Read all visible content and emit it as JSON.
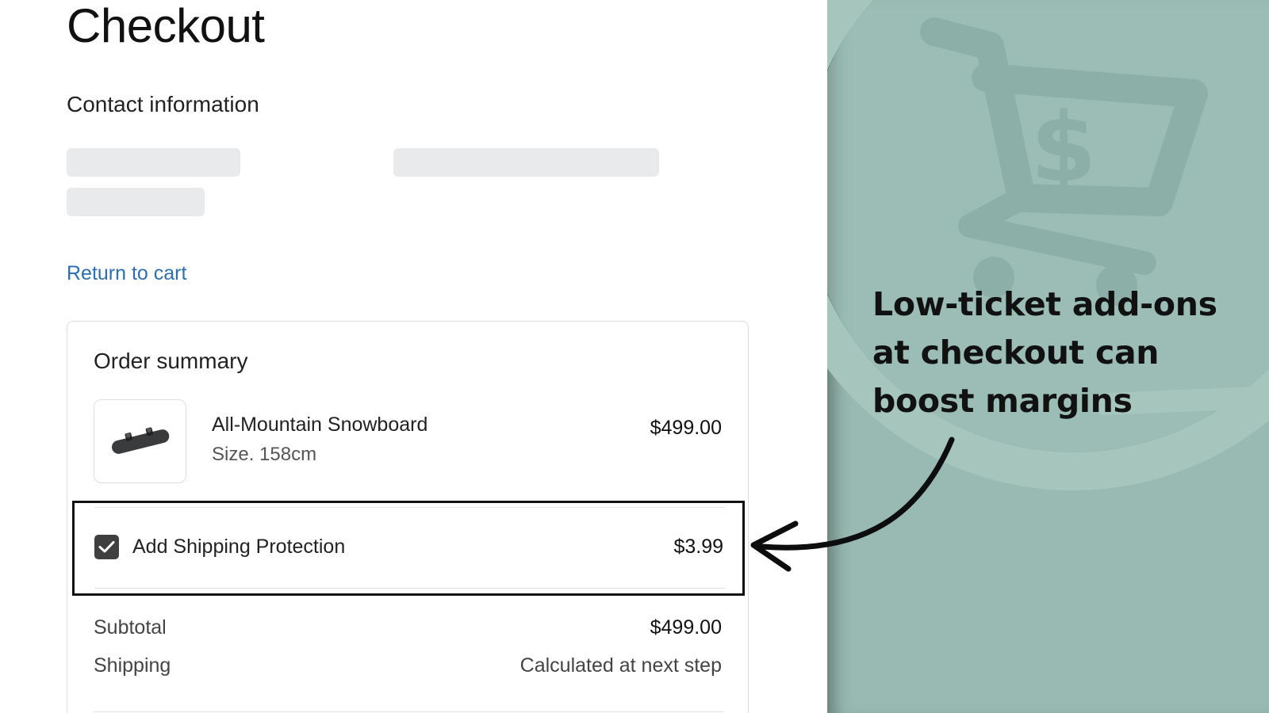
{
  "page": {
    "title": "Checkout"
  },
  "contact": {
    "heading": "Contact information"
  },
  "navigation": {
    "return_label": "Return to cart"
  },
  "order_summary": {
    "heading": "Order summary",
    "item": {
      "name": "All-Mountain Snowboard",
      "variant": "Size. 158cm",
      "price": "$499.00",
      "image_icon": "snowboard-icon"
    },
    "addon": {
      "label": "Add Shipping Protection",
      "price": "$3.99",
      "checked": true
    },
    "subtotal_label": "Subtotal",
    "subtotal_value": "$499.00",
    "shipping_label": "Shipping",
    "shipping_value": "Calculated at next step"
  },
  "promo": {
    "headline": "Low-ticket add-ons at checkout can boost margins",
    "background_icon": "shopping-cart-dollar-icon",
    "background_color": "#98bab2"
  },
  "colors": {
    "link": "#2a6fb3",
    "checkbox": "#3f3f3f",
    "highlight_border": "#111111"
  }
}
